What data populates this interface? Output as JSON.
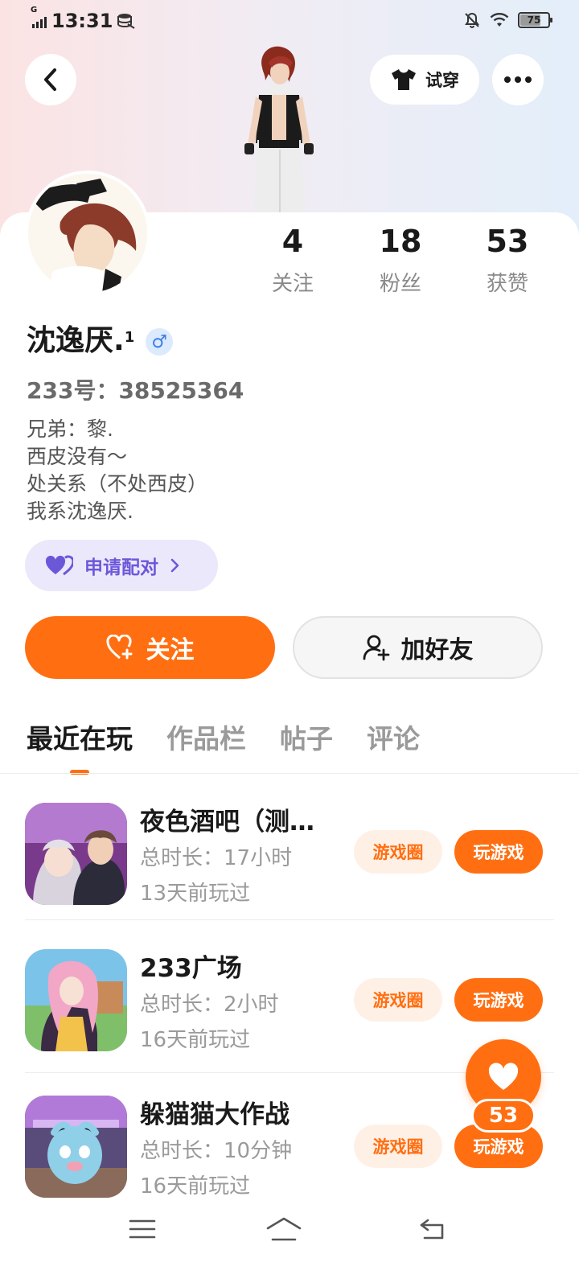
{
  "status_bar": {
    "time": "13:31",
    "network": "G",
    "battery": "75"
  },
  "header": {
    "tryon_label": "试穿"
  },
  "profile": {
    "nickname": "沈逸厌.",
    "nickname_sup": "1",
    "gender_symbol": "♂",
    "account_id": "233号：38525364",
    "bio": [
      "兄弟：黎.",
      "西皮没有～",
      "处关系（不处西皮）",
      "我系沈逸厌."
    ],
    "pair_label": "申请配对"
  },
  "stats": {
    "following": {
      "value": "4",
      "label": "关注"
    },
    "fans": {
      "value": "18",
      "label": "粉丝"
    },
    "likes": {
      "value": "53",
      "label": "获赞"
    }
  },
  "actions": {
    "follow_label": "关注",
    "add_friend_label": "加好友"
  },
  "tabs": [
    "最近在玩",
    "作品栏",
    "帖子",
    "评论"
  ],
  "games": [
    {
      "title": "夜色酒吧（测…",
      "duration": "总时长：17小时",
      "last_played": "13天前玩过",
      "circle_label": "游戏圈",
      "play_label": "玩游戏"
    },
    {
      "title": "233广场",
      "duration": "总时长：2小时",
      "last_played": "16天前玩过",
      "circle_label": "游戏圈",
      "play_label": "玩游戏"
    },
    {
      "title": "躲猫猫大作战",
      "duration": "总时长：10分钟",
      "last_played": "16天前玩过",
      "circle_label": "游戏圈",
      "play_label": "玩游戏"
    }
  ],
  "like_fab": {
    "count": "53"
  },
  "colors": {
    "accent": "#ff6f12",
    "pair": "#6b58d9",
    "gender": "#3d7fe6"
  }
}
